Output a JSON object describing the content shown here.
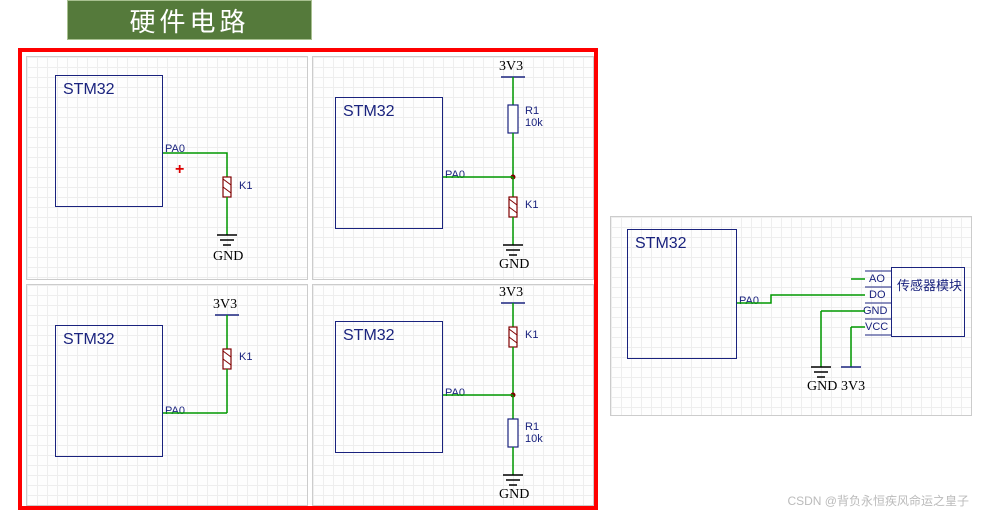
{
  "title": "硬件电路",
  "chips": {
    "stm32": "STM32",
    "pin": "PA0"
  },
  "rails": {
    "v3v3": "3V3",
    "gnd": "GND"
  },
  "components": {
    "k1": "K1",
    "r1": "R1",
    "r1val": "10k"
  },
  "sensor": {
    "module": "传感器模块",
    "ao": "AO",
    "do": "DO",
    "gnd": "GND",
    "vcc": "VCC"
  },
  "watermark": "CSDN @背负永恒疾风命运之皇子"
}
